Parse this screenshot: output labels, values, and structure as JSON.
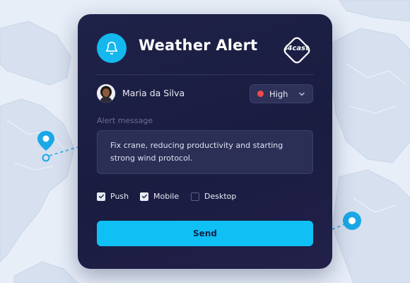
{
  "card": {
    "title": "Weather Alert",
    "logo_text": "i4cast"
  },
  "user": {
    "name": "Maria da Silva"
  },
  "priority": {
    "selected": "High",
    "indicator_color": "#ef4b4b"
  },
  "message": {
    "label": "Alert message",
    "text": "Fix crane, reducing productivity and starting strong wind protocol."
  },
  "channels": [
    {
      "label": "Push",
      "checked": true
    },
    {
      "label": "Mobile",
      "checked": true
    },
    {
      "label": "Desktop",
      "checked": false
    }
  ],
  "send_label": "Send",
  "colors": {
    "accent": "#0fc0f5",
    "card_bg": "#1f2248",
    "map_bg": "#e7eef8",
    "pin": "#1aa8e6"
  },
  "icons": {
    "header": "bell-icon",
    "select": "chevron-down-icon",
    "pins": "map-pin-icon"
  }
}
